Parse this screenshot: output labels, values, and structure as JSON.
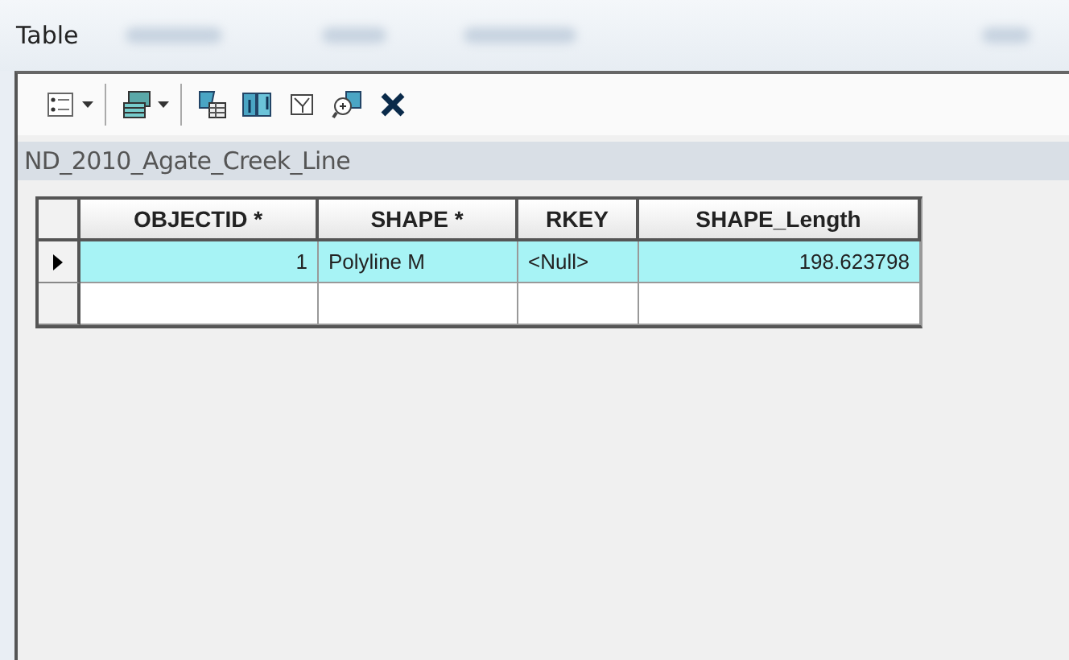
{
  "window": {
    "title": "Table"
  },
  "toolbar": [
    {
      "kind": "options",
      "dropdown": true,
      "separator_after": true
    },
    {
      "kind": "related",
      "dropdown": true,
      "separator_after": true
    },
    {
      "kind": "select",
      "dropdown": false,
      "separator_after": false
    },
    {
      "kind": "switch",
      "dropdown": false,
      "separator_after": false
    },
    {
      "kind": "clear",
      "dropdown": false,
      "separator_after": false
    },
    {
      "kind": "zoom",
      "dropdown": false,
      "separator_after": false
    },
    {
      "kind": "delete",
      "dropdown": false,
      "separator_after": false
    }
  ],
  "table": {
    "name": "ND_2010_Agate_Creek_Line",
    "columns": [
      {
        "label": "OBJECTID *",
        "numeric": true
      },
      {
        "label": "SHAPE *",
        "numeric": false
      },
      {
        "label": "RKEY",
        "numeric": false
      },
      {
        "label": "SHAPE_Length",
        "numeric": true
      }
    ],
    "rows": [
      {
        "cells": [
          "1",
          "Polyline M",
          "<Null>",
          "198.623798"
        ],
        "selected": true,
        "current": true
      }
    ],
    "new_row": true
  }
}
